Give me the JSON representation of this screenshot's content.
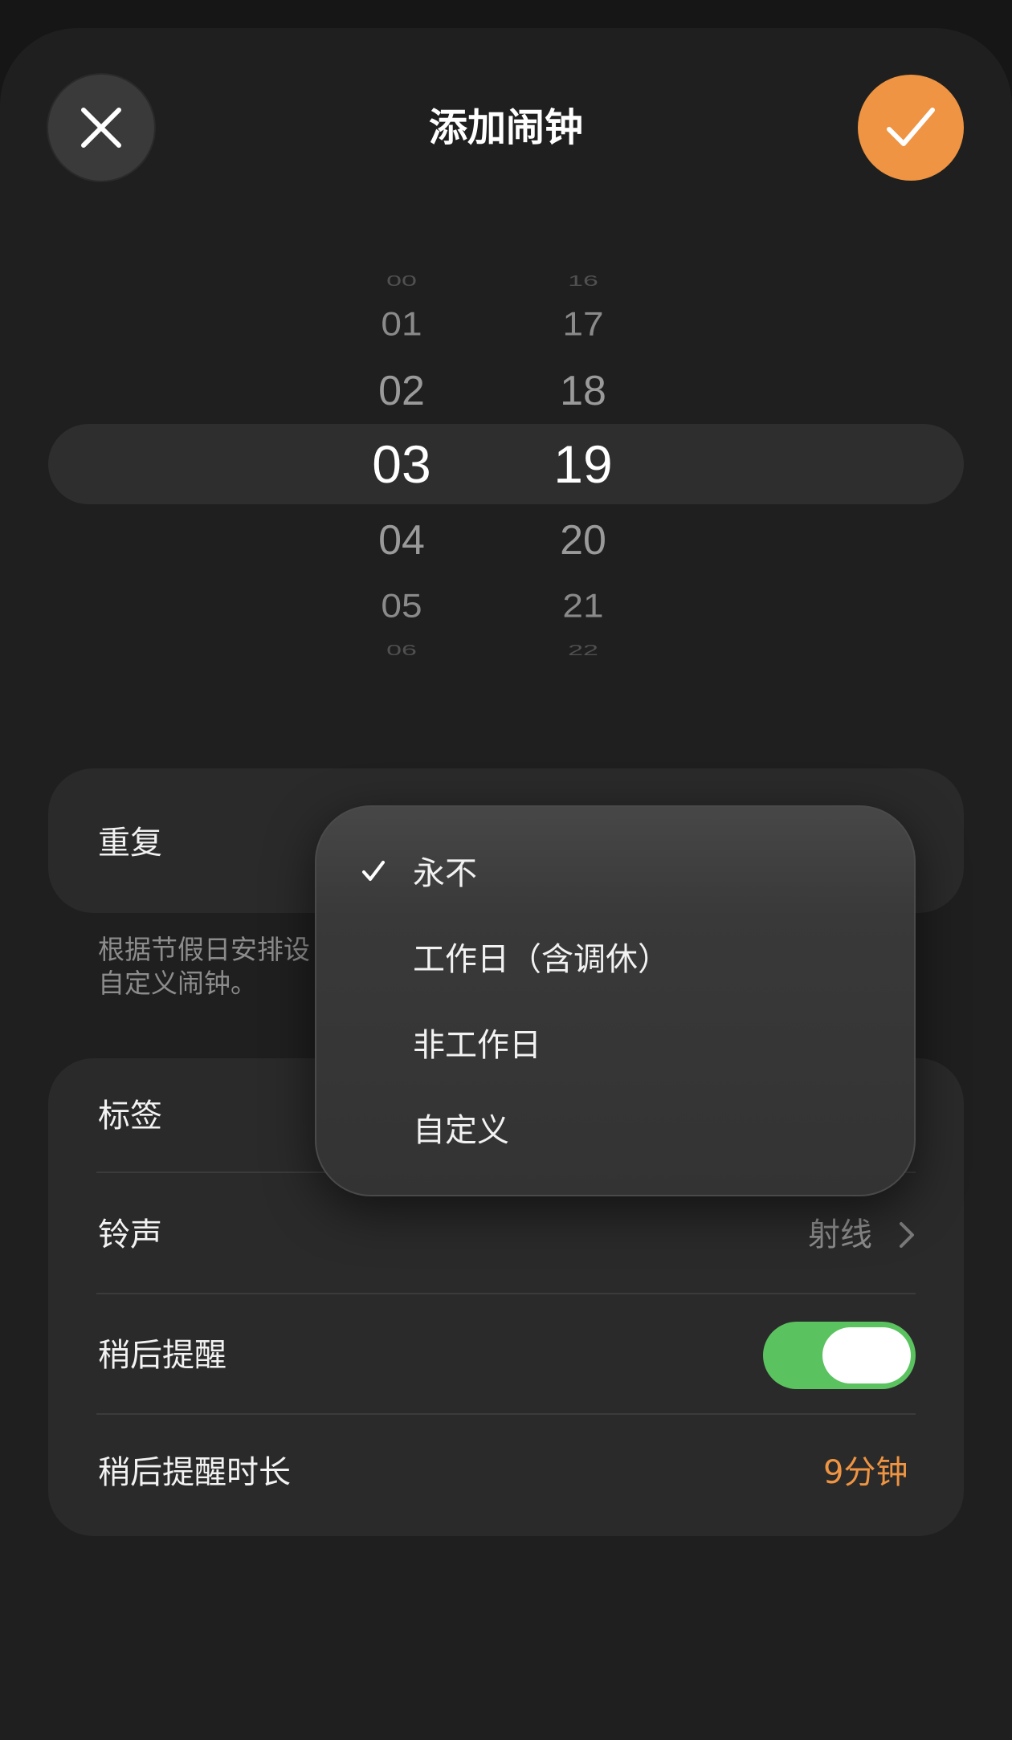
{
  "header": {
    "title": "添加闹钟",
    "close_icon": "close-icon",
    "confirm_icon": "checkmark-icon"
  },
  "time_picker": {
    "hours": [
      "00",
      "01",
      "02",
      "03",
      "04",
      "05",
      "06"
    ],
    "minutes": [
      "16",
      "17",
      "18",
      "19",
      "20",
      "21",
      "22"
    ],
    "selected_hour": "03",
    "selected_minute": "19"
  },
  "repeat": {
    "label": "重复",
    "hint_line1": "根据节假日安排设",
    "hint_line2": "自定义闹钟。"
  },
  "repeat_menu": {
    "items": [
      {
        "label": "永不",
        "checked": true
      },
      {
        "label": "工作日（含调休）",
        "checked": false
      },
      {
        "label": "非工作日",
        "checked": false
      },
      {
        "label": "自定义",
        "checked": false
      }
    ]
  },
  "settings": {
    "tag_label": "标签",
    "ringtone_label": "铃声",
    "ringtone_value": "射线",
    "snooze_label": "稍后提醒",
    "snooze_enabled": true,
    "snooze_duration_label": "稍后提醒时长",
    "snooze_duration_value": "9分钟"
  },
  "colors": {
    "accent": "#ee9442",
    "toggle_on": "#5ac35f",
    "background": "#1f1f1f"
  }
}
